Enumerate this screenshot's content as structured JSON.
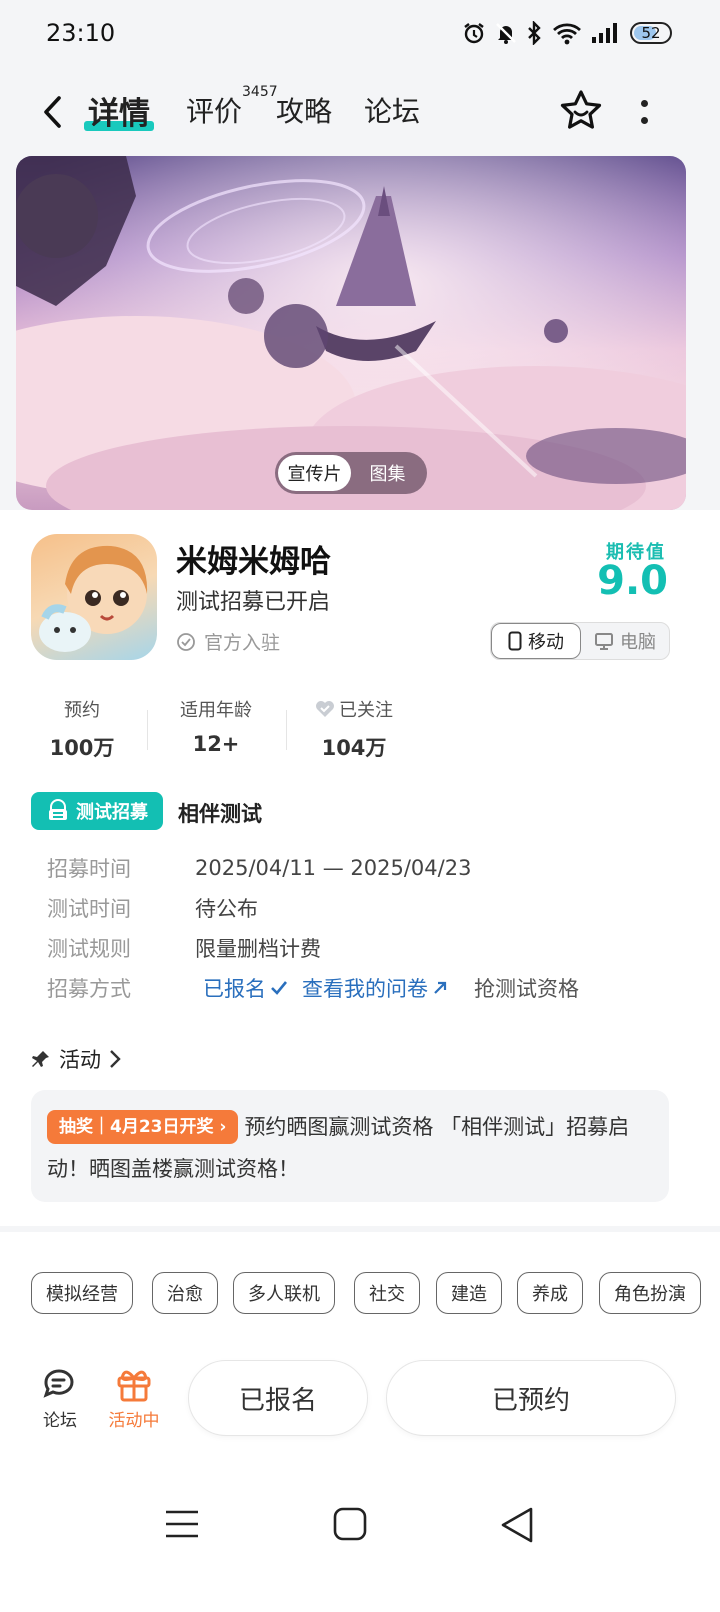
{
  "status": {
    "time": "23:10",
    "battery": "52"
  },
  "nav": {
    "tabs": [
      {
        "label": "详情"
      },
      {
        "label": "评价"
      },
      {
        "label": "攻略"
      },
      {
        "label": "论坛"
      }
    ],
    "review_count": "3457"
  },
  "media": {
    "video_label": "宣传片",
    "gallery_label": "图集"
  },
  "app": {
    "name": "米姆米姆哈",
    "subtitle": "测试招募已开启",
    "official": "官方入驻",
    "expect_label": "期待值",
    "expect_score": "9.0",
    "platforms": [
      "移动",
      "电脑"
    ]
  },
  "stats": [
    {
      "label": "预约",
      "value": "100万"
    },
    {
      "label": "适用年龄",
      "value": "12+"
    },
    {
      "label": "已关注",
      "value": "104万"
    }
  ],
  "test": {
    "badge": "测试招募",
    "title": "相伴测试",
    "rows": [
      {
        "key": "招募时间",
        "value": "2025/04/11 — 2025/04/23"
      },
      {
        "key": "测试时间",
        "value": "待公布"
      },
      {
        "key": "测试规则",
        "value": "限量删档计费"
      }
    ],
    "method_key": "招募方式",
    "method_signed": "已报名",
    "method_survey": "查看我的问卷",
    "method_grab": "抢测试资格"
  },
  "activity": {
    "heading": "活动",
    "lottery": "抽奖｜4月23日开奖",
    "text": "预约晒图赢测试资格 「相伴测试」招募启动！晒图盖楼赢测试资格！"
  },
  "tags": [
    "模拟经营",
    "治愈",
    "多人联机",
    "社交",
    "建造",
    "养成",
    "角色扮演"
  ],
  "bottom": {
    "forum": "论坛",
    "activity": "活动中",
    "signed_button": "已报名",
    "reserved_button": "已预约"
  },
  "colors": {
    "accent": "#13bfb3",
    "orange": "#f57a3a",
    "link": "#2a6fbd"
  }
}
